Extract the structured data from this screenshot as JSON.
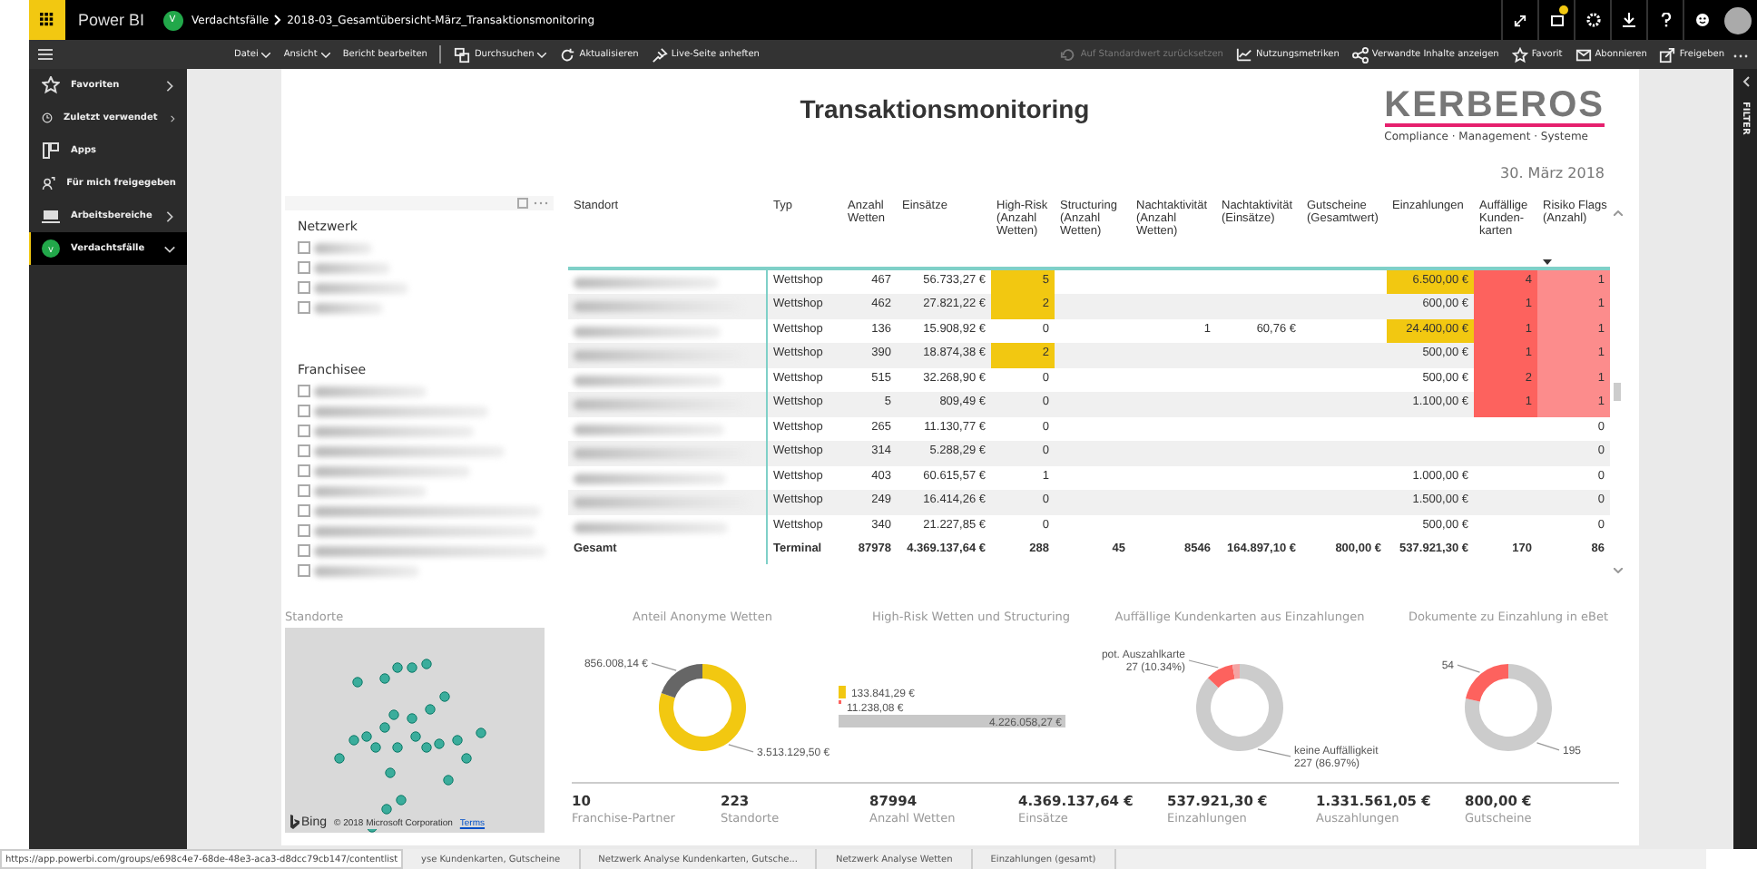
{
  "app_bar": {
    "product": "Power BI",
    "workspace_badge": "V",
    "breadcrumb": [
      "Verdachtsfälle",
      "2018-03_Gesamtübersicht-März_Transaktionsmonitoring"
    ]
  },
  "toolbar": {
    "left": [
      {
        "label": "Datei",
        "menu": true,
        "disabled": false
      },
      {
        "label": "Ansicht",
        "menu": true,
        "disabled": false
      },
      {
        "label": "Bericht bearbeiten",
        "menu": false,
        "disabled": false
      },
      {
        "label": "Durchsuchen",
        "menu": true,
        "disabled": false
      },
      {
        "label": "Aktualisieren",
        "menu": false,
        "disabled": false
      },
      {
        "label": "Live-Seite anheften",
        "menu": false,
        "disabled": false
      }
    ],
    "right": [
      {
        "label": "Auf Standardwert zurücksetzen",
        "menu": false,
        "disabled": true
      },
      {
        "label": "Nutzungsmetriken",
        "menu": false,
        "disabled": false
      },
      {
        "label": "Verwandte Inhalte anzeigen",
        "menu": false,
        "disabled": false
      },
      {
        "label": "Favorit",
        "menu": false,
        "disabled": false
      },
      {
        "label": "Abonnieren",
        "menu": false,
        "disabled": false
      },
      {
        "label": "Freigeben",
        "menu": false,
        "disabled": false
      }
    ]
  },
  "sidebar": {
    "items": [
      {
        "label": "Favoriten",
        "kind": "group",
        "expanded": false,
        "selected": false
      },
      {
        "label": "Zuletzt verwendet",
        "kind": "group",
        "expanded": false,
        "selected": false
      },
      {
        "label": "Apps",
        "kind": "link",
        "selected": false
      },
      {
        "label": "Für mich freigegeben",
        "kind": "link",
        "selected": false
      },
      {
        "label": "Arbeitsbereiche",
        "kind": "group",
        "expanded": false,
        "selected": false
      },
      {
        "label": "Verdachtsfälle",
        "kind": "group",
        "expanded": true,
        "selected": true,
        "badge": "V"
      }
    ]
  },
  "report": {
    "title": "Transaktionsmonitoring",
    "logo": {
      "name": "KERBEROS",
      "tagline": "Compliance · Management · Systeme"
    },
    "date": "30. März 2018",
    "slicers": [
      {
        "title": "Netzwerk",
        "items": [
          {
            "checked": false
          },
          {
            "checked": false
          },
          {
            "checked": false
          },
          {
            "checked": false
          }
        ]
      },
      {
        "title": "Franchisee",
        "items": [
          {
            "checked": false
          },
          {
            "checked": false
          },
          {
            "checked": false
          },
          {
            "checked": false
          },
          {
            "checked": false
          },
          {
            "checked": false
          },
          {
            "checked": false
          },
          {
            "checked": false
          },
          {
            "checked": false
          },
          {
            "checked": false
          }
        ]
      }
    ],
    "table": {
      "columns": [
        {
          "label": "Standort",
          "sorted": false
        },
        {
          "label": "Typ",
          "sorted": false
        },
        {
          "label": "Anzahl Wetten",
          "sorted": false
        },
        {
          "label": "Einsätze",
          "sorted": false
        },
        {
          "label": "High-Risk (Anzahl Wetten)",
          "sorted": false
        },
        {
          "label": "Structuring (Anzahl Wetten)",
          "sorted": false
        },
        {
          "label": "Nachtaktivität (Anzahl Wetten)",
          "sorted": false
        },
        {
          "label": "Nachtaktivität (Einsätze)",
          "sorted": false
        },
        {
          "label": "Gutscheine (Gesamtwert)",
          "sorted": false
        },
        {
          "label": "Einzahlungen",
          "sorted": false
        },
        {
          "label": "Auffällige Kunden-karten",
          "sorted": false
        },
        {
          "label": "Risiko Flags (Anzahl)",
          "sorted": true
        }
      ],
      "rows": [
        {
          "cells": [
            null,
            "Wettshop",
            "467",
            "56.733,27 €",
            "5",
            null,
            null,
            null,
            null,
            "6.500,00 €",
            "4",
            "1"
          ],
          "high_risk_flagged": true,
          "einzahlung_flagged": true,
          "risk_flagged": true
        },
        {
          "cells": [
            null,
            "Wettshop",
            "462",
            "27.821,22 €",
            "2",
            null,
            null,
            null,
            null,
            "600,00 €",
            "1",
            "1"
          ],
          "high_risk_flagged": true,
          "einzahlung_flagged": false,
          "risk_flagged": true
        },
        {
          "cells": [
            null,
            "Wettshop",
            "136",
            "15.908,92 €",
            "0",
            null,
            "1",
            "60,76 €",
            null,
            "24.400,00 €",
            "1",
            "1"
          ],
          "high_risk_flagged": false,
          "einzahlung_flagged": true,
          "risk_flagged": true
        },
        {
          "cells": [
            null,
            "Wettshop",
            "390",
            "18.874,38 €",
            "2",
            null,
            null,
            null,
            null,
            "500,00 €",
            "1",
            "1"
          ],
          "high_risk_flagged": true,
          "einzahlung_flagged": false,
          "risk_flagged": true
        },
        {
          "cells": [
            null,
            "Wettshop",
            "515",
            "32.268,90 €",
            "0",
            null,
            null,
            null,
            null,
            "500,00 €",
            "2",
            "1"
          ],
          "high_risk_flagged": false,
          "einzahlung_flagged": false,
          "risk_flagged": true
        },
        {
          "cells": [
            null,
            "Wettshop",
            "5",
            "809,49 €",
            "0",
            null,
            null,
            null,
            null,
            "1.100,00 €",
            "1",
            "1"
          ],
          "high_risk_flagged": false,
          "einzahlung_flagged": false,
          "risk_flagged": true
        },
        {
          "cells": [
            null,
            "Wettshop",
            "265",
            "11.130,77 €",
            "0",
            null,
            null,
            null,
            null,
            null,
            null,
            "0"
          ],
          "high_risk_flagged": false,
          "einzahlung_flagged": false,
          "risk_flagged": false
        },
        {
          "cells": [
            null,
            "Wettshop",
            "314",
            "5.288,29 €",
            "0",
            null,
            null,
            null,
            null,
            null,
            null,
            "0"
          ],
          "high_risk_flagged": false,
          "einzahlung_flagged": false,
          "risk_flagged": false
        },
        {
          "cells": [
            null,
            "Wettshop",
            "403",
            "60.615,57 €",
            "1",
            null,
            null,
            null,
            null,
            "1.000,00 €",
            null,
            "0"
          ],
          "high_risk_flagged": false,
          "einzahlung_flagged": false,
          "risk_flagged": false
        },
        {
          "cells": [
            null,
            "Wettshop",
            "249",
            "16.414,26 €",
            "0",
            null,
            null,
            null,
            null,
            "1.500,00 €",
            null,
            "0"
          ],
          "high_risk_flagged": false,
          "einzahlung_flagged": false,
          "risk_flagged": false
        },
        {
          "cells": [
            null,
            "Wettshop",
            "340",
            "21.227,85 €",
            "0",
            null,
            null,
            null,
            null,
            "500,00 €",
            null,
            "0"
          ],
          "high_risk_flagged": false,
          "einzahlung_flagged": false,
          "risk_flagged": false
        }
      ],
      "total": [
        "Gesamt",
        "Terminal",
        "87978",
        "4.369.137,64 €",
        "288",
        "45",
        "8546",
        "164.897,10 €",
        "800,00 €",
        "537.921,30 €",
        "170",
        "86"
      ]
    },
    "map": {
      "title": "Standorte",
      "provider": "Bing",
      "copyright": "© 2018 Microsoft Corporation",
      "terms_link": "Terms"
    },
    "charts": [
      {
        "chart_data": {
          "type": "donut",
          "title": "Anteil Anonyme Wetten",
          "values": [
            3513129.5,
            856008.14
          ],
          "colors": [
            "#f2c811",
            "#666666"
          ],
          "data_labels": true,
          "value_labels": [
            "3.513.129,50 €",
            "856.008,14 €"
          ]
        }
      },
      {
        "chart_data": {
          "type": "bar",
          "title": "High-Risk Wetten und Structuring",
          "orientation": "horizontal",
          "series": [
            {
              "color": "#f2c811",
              "values": [
                133841.29
              ],
              "value_labels": [
                "133.841,29 €"
              ]
            },
            {
              "color": "#fd625e",
              "values": [
                11238.08
              ],
              "value_labels": [
                "11.238,08 €"
              ]
            },
            {
              "color": "#c8c8c8",
              "values": [
                4226058.27
              ],
              "value_labels": [
                "4.226.058,27 €"
              ]
            }
          ],
          "data_labels": true
        }
      },
      {
        "chart_data": {
          "type": "donut",
          "title": "Auffällige Kundenkarten aus Einzahlungen",
          "values": [
            227,
            27,
            7
          ],
          "colors": [
            "#cccccc",
            "#fd625e",
            "#f4a3a3"
          ],
          "data_labels": true,
          "value_labels": [
            "keine Auffälligkeit\n227 (86.97%)",
            "pot. Auszahlkarte\n27 (10.34%)",
            null
          ]
        }
      },
      {
        "chart_data": {
          "type": "donut",
          "title": "Dokumente zu Einzahlung in eBet",
          "values": [
            195,
            54
          ],
          "colors": [
            "#cccccc",
            "#fd625e"
          ],
          "data_labels": true,
          "value_labels": [
            "195",
            "54"
          ]
        }
      }
    ],
    "cards": [
      {
        "value": "10",
        "label": "Franchise-Partner"
      },
      {
        "value": "223",
        "label": "Standorte"
      },
      {
        "value": "87994",
        "label": "Anzahl Wetten"
      },
      {
        "value": "4.369.137,64 €",
        "label": "Einsätze"
      },
      {
        "value": "537.921,30 €",
        "label": "Einzahlungen"
      },
      {
        "value": "1.331.561,05 €",
        "label": "Auszahlungen"
      },
      {
        "value": "800,00 €",
        "label": "Gutscheine"
      }
    ]
  },
  "filter_pane": {
    "label": "FILTER"
  },
  "status_bar": {
    "url": "https://app.powerbi.com/groups/e698c4e7-68de-48e3-aca3-d8dcc79cb147/contentlist",
    "page_tabs": [
      {
        "label": "yse Kundenkarten, Gutscheine",
        "selected": false
      },
      {
        "label": "Netzwerk Analyse Kundenkarten, Gutsche...",
        "selected": false
      },
      {
        "label": "Netzwerk Analyse Wetten",
        "selected": false
      },
      {
        "label": "Einzahlungen (gesamt)",
        "selected": false
      }
    ]
  }
}
